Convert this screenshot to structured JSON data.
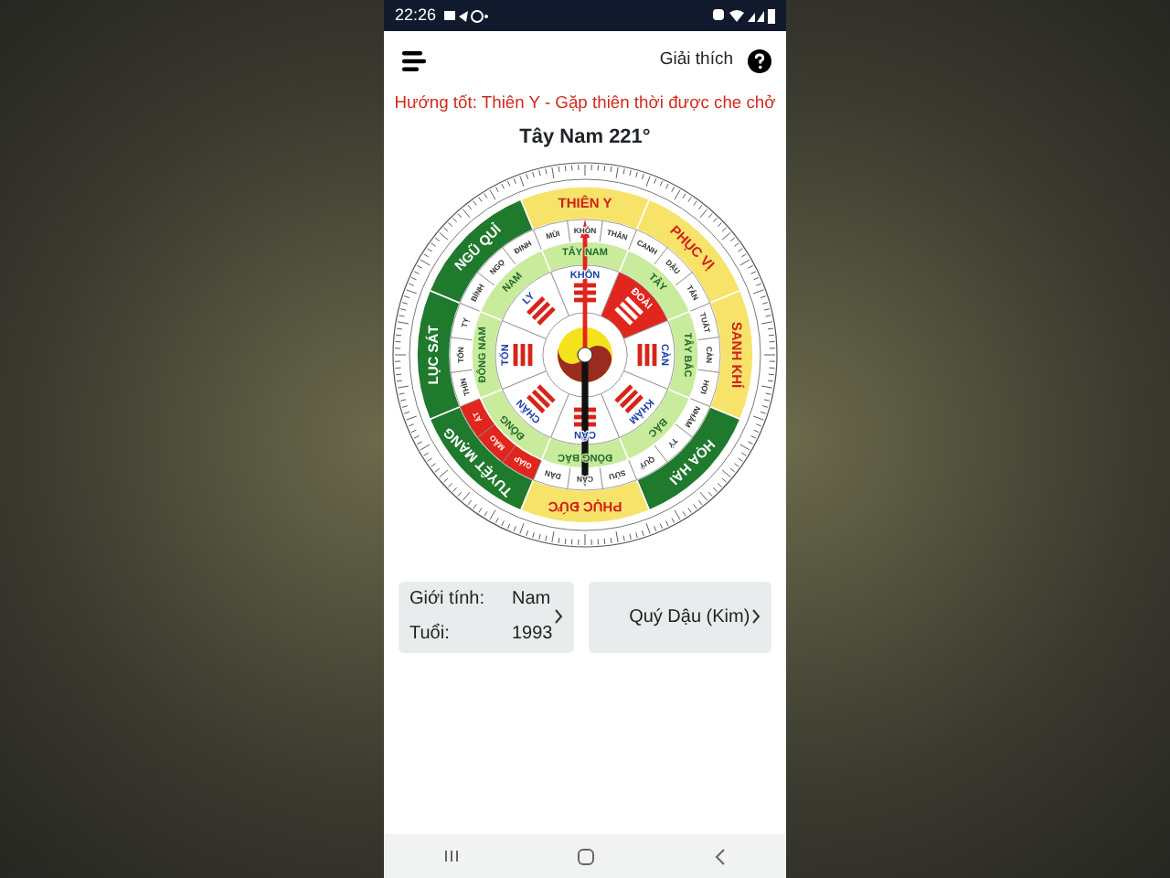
{
  "status_bar": {
    "time": "22:26"
  },
  "header": {
    "help_label": "Giải thích"
  },
  "advice": "Hướng tốt: Thiên Y - Gặp thiên thời được che chở",
  "heading": "Tây Nam 221°",
  "compass": {
    "sectors": [
      {
        "label": "THIÊN Y",
        "kind": "good"
      },
      {
        "label": "PHỤC VỊ",
        "kind": "good"
      },
      {
        "label": "SANH KHÍ",
        "kind": "good"
      },
      {
        "label": "HỌA HẠI",
        "kind": "bad"
      },
      {
        "label": "PHỤC ĐỨC",
        "kind": "good"
      },
      {
        "label": "TUYỆT MẠNG",
        "kind": "bad"
      },
      {
        "label": "LỤC SÁT",
        "kind": "bad"
      },
      {
        "label": "NGŨ QUỈ",
        "kind": "bad"
      }
    ],
    "mountains": [
      {
        "label": "MÙI",
        "highlighted": false
      },
      {
        "label": "KHÔN",
        "highlighted": false
      },
      {
        "label": "THÂN",
        "highlighted": false
      },
      {
        "label": "CANH",
        "highlighted": false
      },
      {
        "label": "DẬU",
        "highlighted": false
      },
      {
        "label": "TÂN",
        "highlighted": false
      },
      {
        "label": "TUẤT",
        "highlighted": false
      },
      {
        "label": "CÀN",
        "highlighted": false
      },
      {
        "label": "HỢI",
        "highlighted": false
      },
      {
        "label": "NHÂM",
        "highlighted": false
      },
      {
        "label": "TÝ",
        "highlighted": false
      },
      {
        "label": "QUÝ",
        "highlighted": false
      },
      {
        "label": "SỬU",
        "highlighted": false
      },
      {
        "label": "CẤN",
        "highlighted": false
      },
      {
        "label": "DẦN",
        "highlighted": false
      },
      {
        "label": "GIÁP",
        "highlighted": true
      },
      {
        "label": "MÃO",
        "highlighted": true
      },
      {
        "label": "ẤT",
        "highlighted": true
      },
      {
        "label": "THÌN",
        "highlighted": false
      },
      {
        "label": "TỐN",
        "highlighted": false
      },
      {
        "label": "TỴ",
        "highlighted": false
      },
      {
        "label": "BÍNH",
        "highlighted": false
      },
      {
        "label": "NGỌ",
        "highlighted": false
      },
      {
        "label": "ĐINH",
        "highlighted": false
      }
    ],
    "directions": [
      "TÂY NAM",
      "TÂY",
      "TÂY BẮC",
      "BẮC",
      "ĐÔNG BẮC",
      "ĐÔNG",
      "ĐÔNG NAM",
      "NAM"
    ],
    "trigrams": [
      {
        "label": "KHÔN",
        "highlighted": false
      },
      {
        "label": "ĐOÀI",
        "highlighted": true
      },
      {
        "label": "CÀN",
        "highlighted": false
      },
      {
        "label": "KHẢM",
        "highlighted": false
      },
      {
        "label": "CẤN",
        "highlighted": false
      },
      {
        "label": "CHẤN",
        "highlighted": false
      },
      {
        "label": "TỐN",
        "highlighted": false
      },
      {
        "label": "LY",
        "highlighted": false
      }
    ]
  },
  "cards": [
    {
      "kind": "profile",
      "rows": [
        {
          "label": "Giới tính:",
          "value": "Nam"
        },
        {
          "label": "Tuổi:",
          "value": "1993"
        }
      ]
    },
    {
      "kind": "element",
      "text": "Quý Dậu (Kim)"
    }
  ]
}
